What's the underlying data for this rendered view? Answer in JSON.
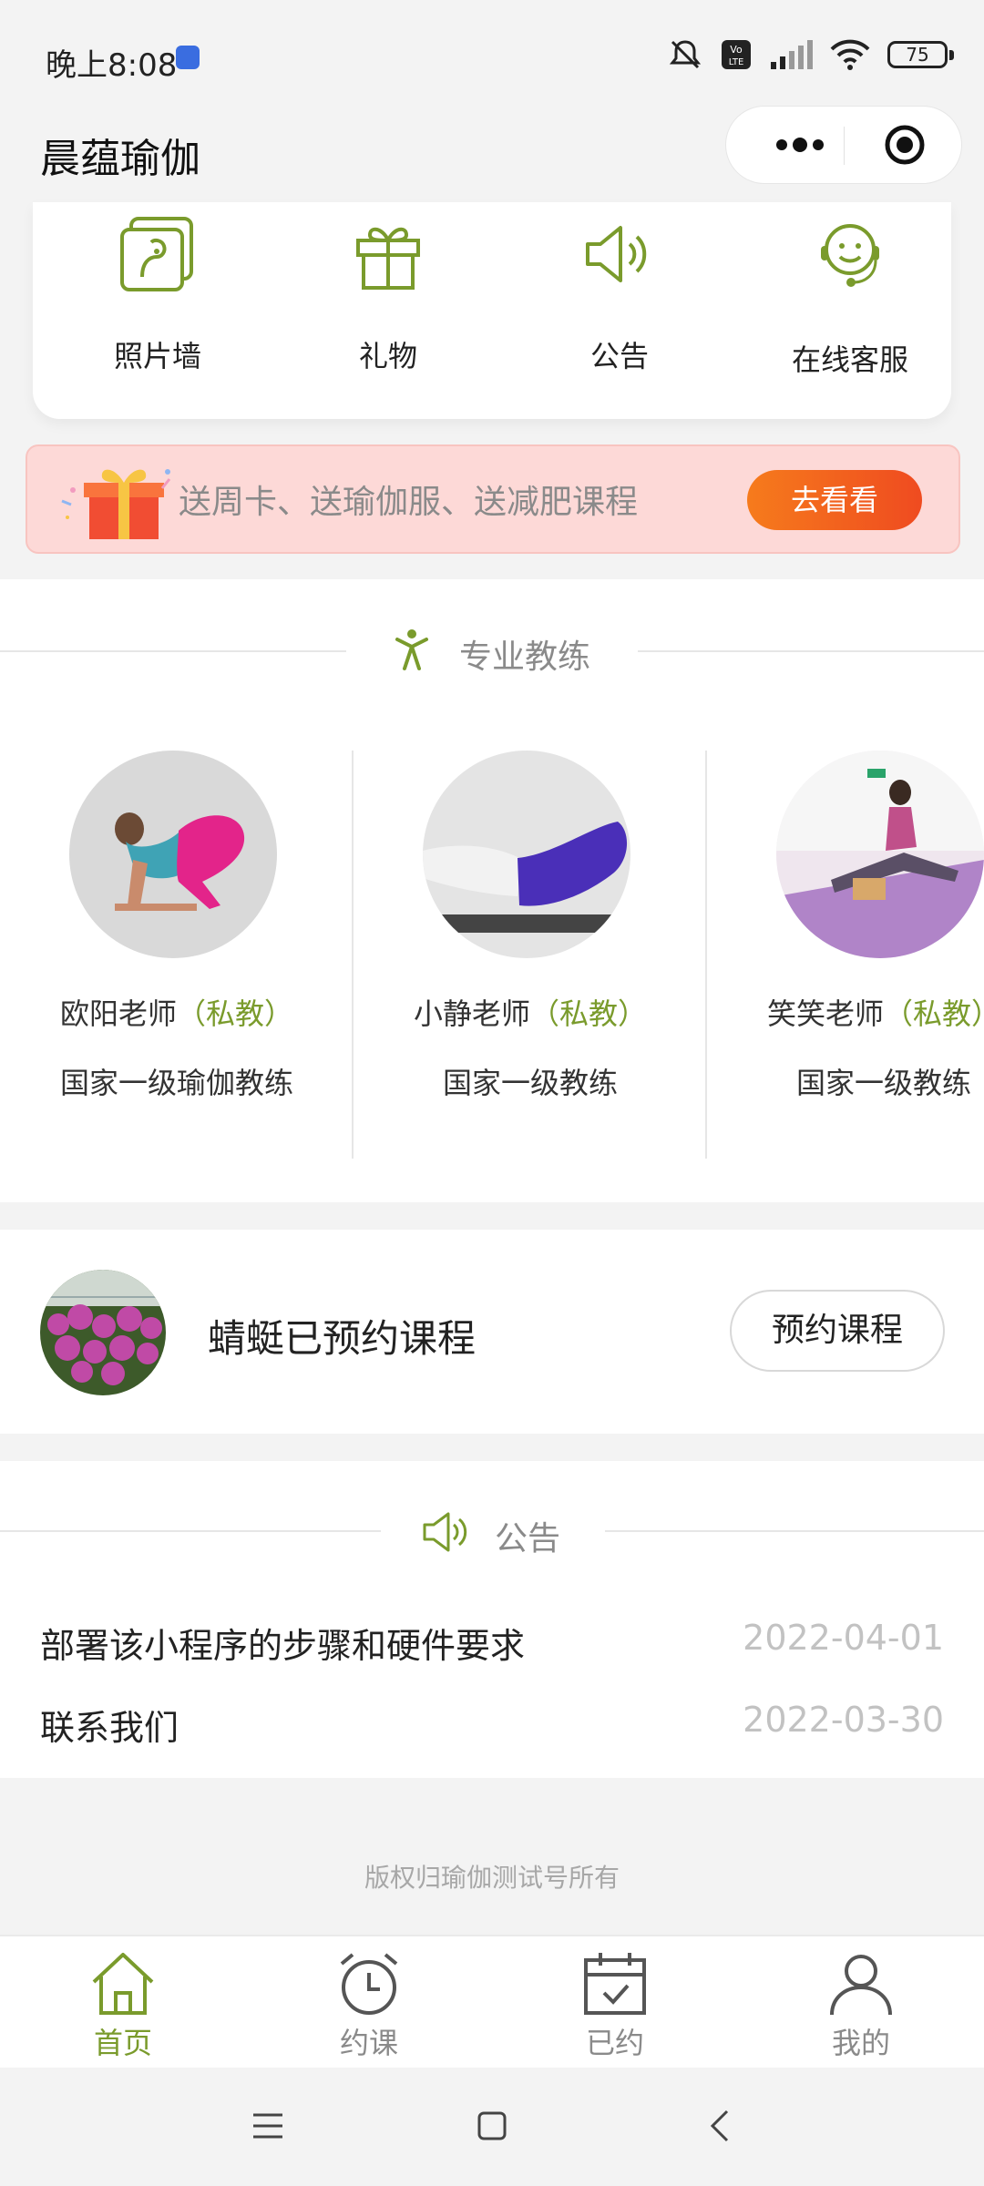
{
  "status_bar": {
    "time": "晚上8:08",
    "battery": "75"
  },
  "nav": {
    "title": "晨蕴瑜伽"
  },
  "menu": [
    {
      "label": "照片墙",
      "icon": "photo-wall-icon"
    },
    {
      "label": "礼物",
      "icon": "gift-icon"
    },
    {
      "label": "公告",
      "icon": "speaker-icon"
    },
    {
      "label": "在线客服",
      "icon": "customer-service-icon"
    }
  ],
  "promo": {
    "text": "送周卡、送瑜伽服、送减肥课程",
    "button": "去看看"
  },
  "coaches_section": {
    "title": "专业教练"
  },
  "coaches": [
    {
      "name": "欧阳老师",
      "tag": "（私教）",
      "desc": "国家一级瑜伽教练"
    },
    {
      "name": "小静老师",
      "tag": "（私教）",
      "desc": "国家一级教练"
    },
    {
      "name": "笑笑老师",
      "tag": "（私教）",
      "desc": "国家一级教练"
    }
  ],
  "booking": {
    "text": "蜻蜓已预约课程",
    "button": "预约课程"
  },
  "notice_section": {
    "title": "公告"
  },
  "notices": [
    {
      "title": "部署该小程序的步骤和硬件要求",
      "date": "2022-04-01"
    },
    {
      "title": "联系我们",
      "date": "2022-03-30"
    }
  ],
  "footer": {
    "copyright": "版权归瑜伽测试号所有"
  },
  "tabs": [
    {
      "label": "首页",
      "icon": "home-icon",
      "active": true
    },
    {
      "label": "约课",
      "icon": "alarm-clock-icon"
    },
    {
      "label": "已约",
      "icon": "calendar-check-icon"
    },
    {
      "label": "我的",
      "icon": "user-icon"
    }
  ],
  "colors": {
    "accent": "#7a9b2c",
    "promo_button": "#f2611e",
    "background": "#f3f3f3"
  }
}
